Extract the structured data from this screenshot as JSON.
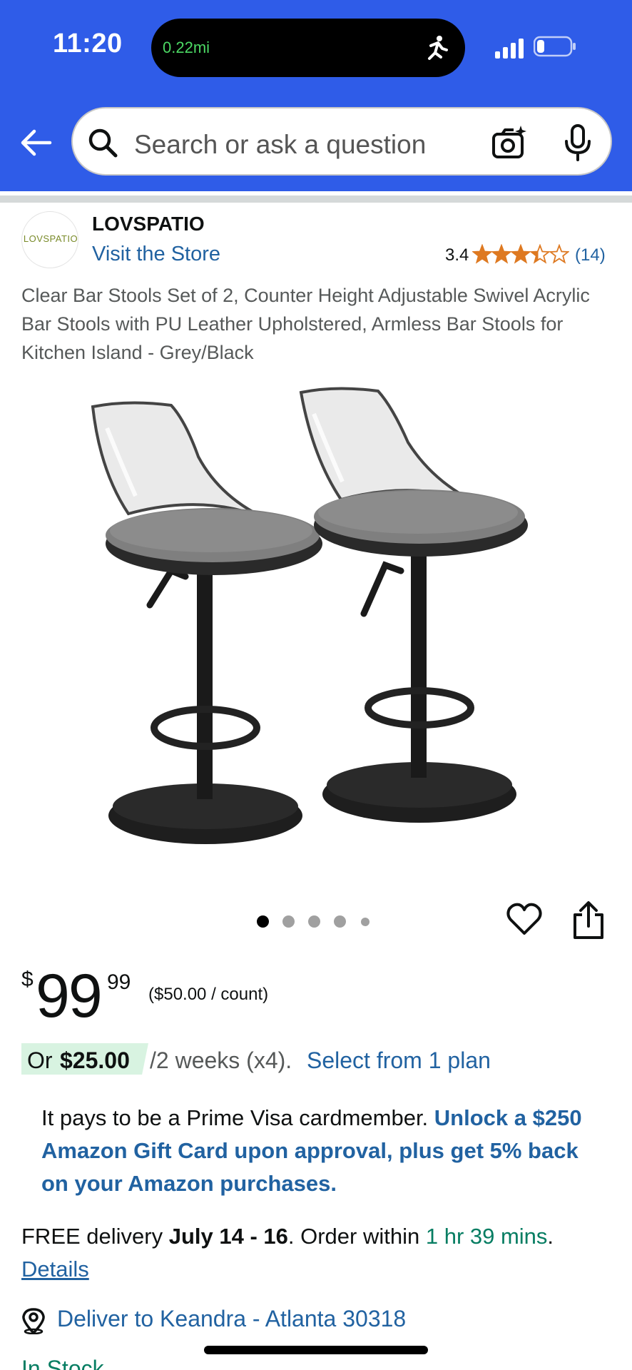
{
  "status_bar": {
    "time": "11:20",
    "activity_distance": "0.22mi",
    "activity_icon": "runner-icon",
    "signal_icon": "cellular-signal-icon",
    "battery_icon": "battery-icon"
  },
  "search": {
    "placeholder": "Search or ask a question",
    "icons": [
      "back-arrow-icon",
      "search-icon",
      "camera-icon",
      "microphone-icon"
    ]
  },
  "store": {
    "logo_text": "LOVSPATIO",
    "name": "LOVSPATIO",
    "visit_label": "Visit the Store",
    "rating": "3.4",
    "rating_fraction": 0.68,
    "review_count": "(14)"
  },
  "product": {
    "title": "Clear Bar Stools Set of 2, Counter Height Adjustable Swivel Acrylic Bar Stools with PU Leather Upholstered, Armless Bar Stools for Kitchen Island - Grey/Black",
    "image_count": 5,
    "image_index": 1
  },
  "price": {
    "symbol": "$",
    "whole": "99",
    "fraction": "99",
    "unit_price": "($50.00 / count)"
  },
  "installment": {
    "prefix": "Or",
    "amount": "$25.00",
    "terms": "/2 weeks (x4).",
    "link": "Select from 1 plan"
  },
  "prime_offer": {
    "text": "It pays to be a Prime Visa cardmember. ",
    "link": "Unlock a $250 Amazon Gift Card upon approval, plus get 5% back on your Amazon purchases."
  },
  "delivery": {
    "prefix": "FREE delivery ",
    "dates": "July 14 - 16",
    "middle": ". Order within ",
    "countdown": "1 hr 39 mins",
    "suffix": ".",
    "details_link": "Details"
  },
  "location": {
    "label": "Deliver to Keandra - Atlanta 30318"
  },
  "stock": {
    "label": "In Stock"
  },
  "colors": {
    "header_blue": "#2f5ce8",
    "link_blue": "#2162a1",
    "star_orange": "#de7921",
    "green": "#067d62",
    "installment_bg": "#d8f3e1"
  }
}
